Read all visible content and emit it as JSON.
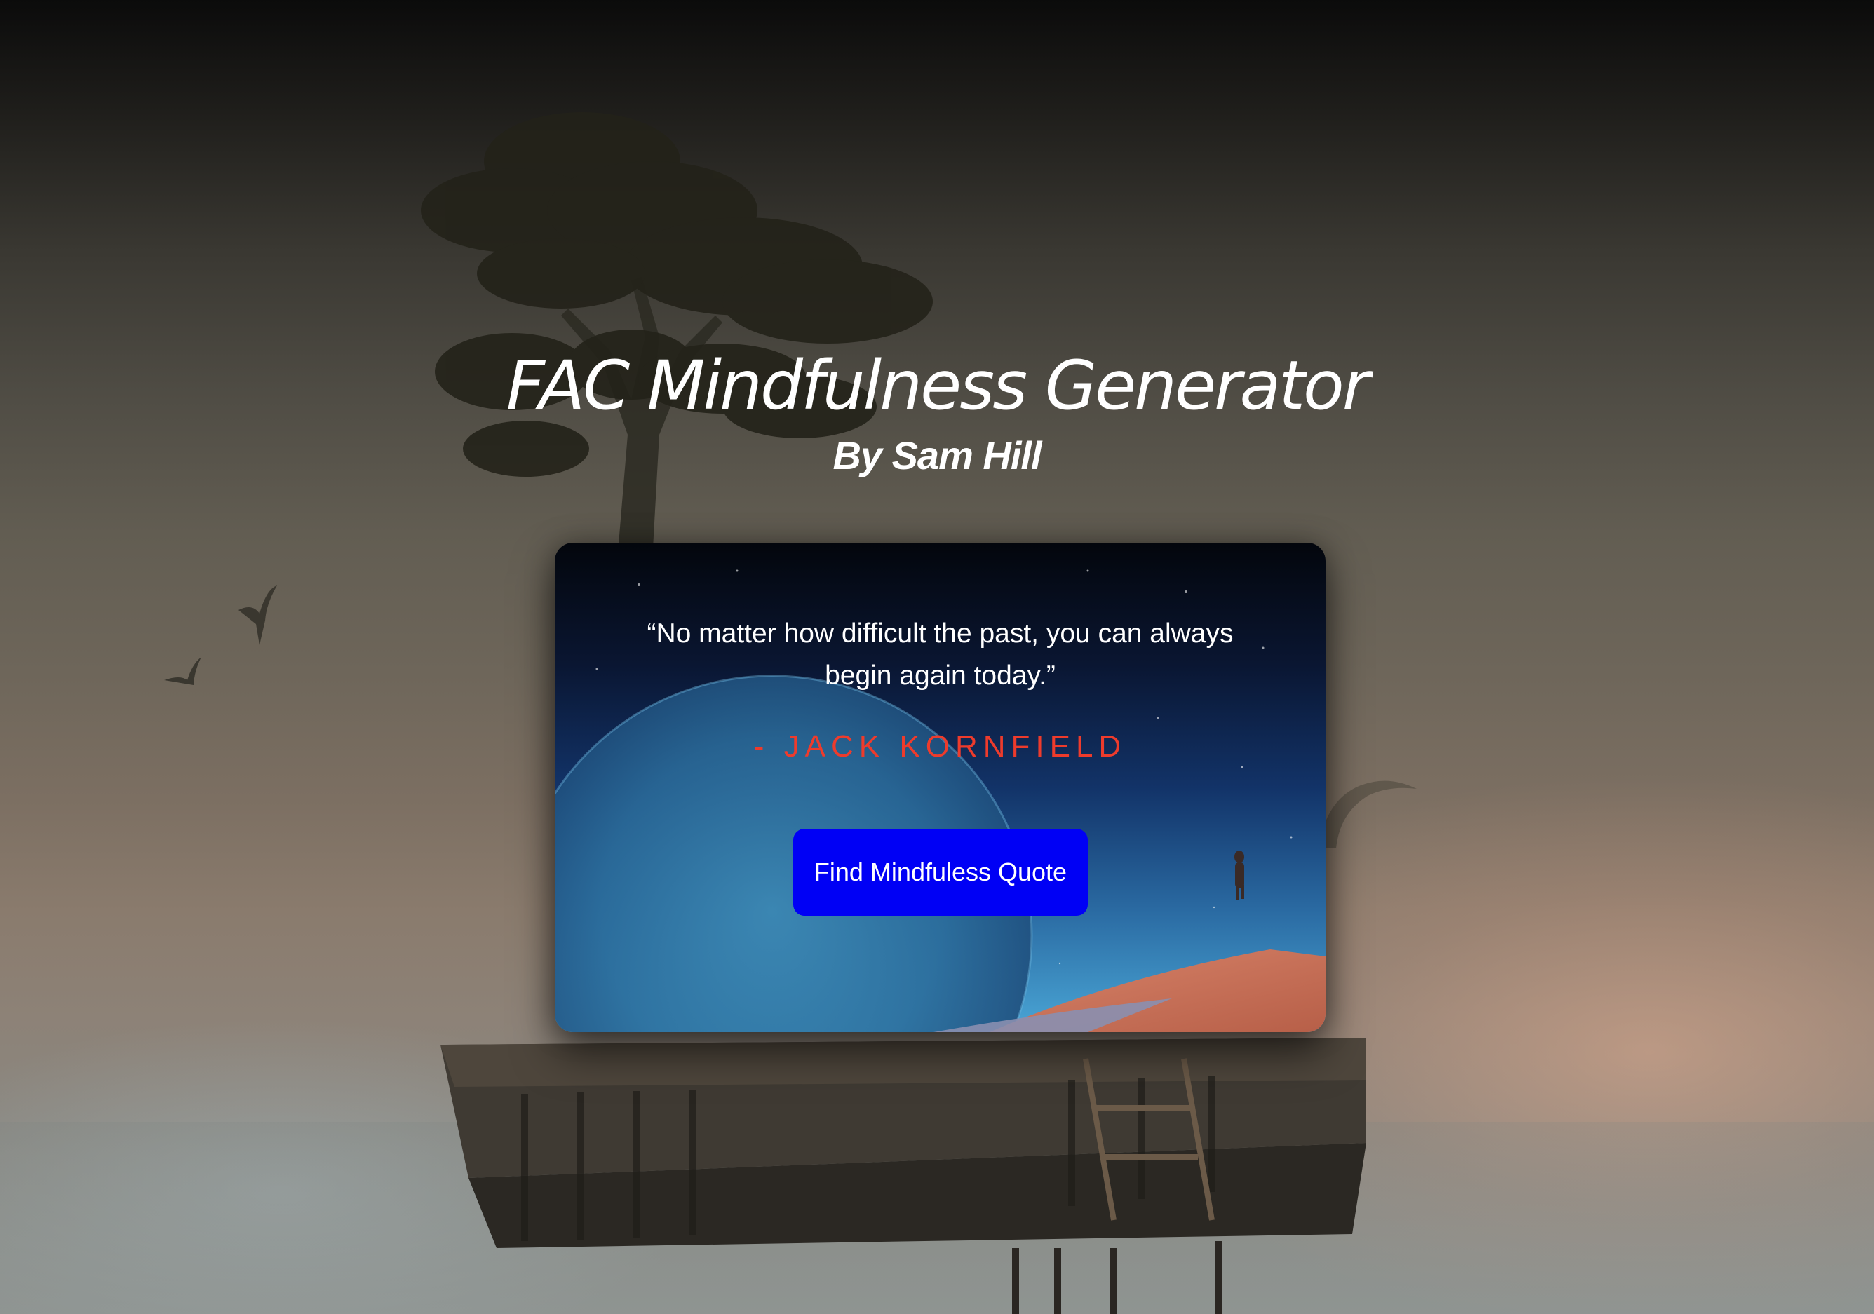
{
  "header": {
    "title": "FAC Mindfulness Generator",
    "subtitle": "By Sam Hill"
  },
  "card": {
    "quote": "“No matter how difficult the past, you can always begin again today.”",
    "author": "- Jack Kornfield",
    "button_label": "Find Mindfuless Quote"
  },
  "colors": {
    "author": "#ee3b2c",
    "button": "#0000f5",
    "title": "#ffffff"
  }
}
